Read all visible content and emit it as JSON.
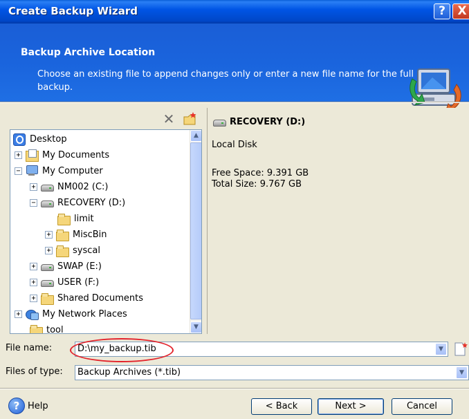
{
  "window": {
    "title": "Create Backup Wizard",
    "help_glyph": "?",
    "close_glyph": "X"
  },
  "header": {
    "title": "Backup Archive Location",
    "description": "Choose an existing file to append changes only or enter a new file name for the full backup.",
    "icon": "backup-computer-icon"
  },
  "toolbar": {
    "delete_glyph": "✕",
    "new_folder_icon": "new-folder-icon"
  },
  "tree": {
    "items": [
      {
        "label": "Desktop",
        "icon": "desktop-icon",
        "expander": ""
      },
      {
        "label": "My Documents",
        "icon": "documents-icon",
        "expander": "+"
      },
      {
        "label": "My Computer",
        "icon": "computer-icon",
        "expander": "−"
      },
      {
        "label": "NM002 (C:)",
        "icon": "drive-icon",
        "expander": "+"
      },
      {
        "label": "RECOVERY (D:)",
        "icon": "drive-icon",
        "expander": "−"
      },
      {
        "label": "limit",
        "icon": "folder-icon",
        "expander": ""
      },
      {
        "label": "MiscBin",
        "icon": "folder-icon",
        "expander": "+"
      },
      {
        "label": "syscal",
        "icon": "folder-icon",
        "expander": "+"
      },
      {
        "label": "SWAP (E:)",
        "icon": "drive-icon",
        "expander": "+"
      },
      {
        "label": "USER (F:)",
        "icon": "drive-icon",
        "expander": "+"
      },
      {
        "label": "Shared Documents",
        "icon": "folder-icon",
        "expander": "+"
      },
      {
        "label": "My Network Places",
        "icon": "network-icon",
        "expander": "+"
      },
      {
        "label": "tool",
        "icon": "folder-icon",
        "expander": ""
      }
    ]
  },
  "info": {
    "drive_name": "RECOVERY (D:)",
    "type": "Local Disk",
    "free_space": "Free Space: 9.391 GB",
    "total_size": "Total Size: 9.767 GB"
  },
  "file_name": {
    "label": "File name:",
    "value": "D:\\my_backup.tib"
  },
  "file_type": {
    "label": "Files of type:",
    "value": "Backup Archives (*.tib)"
  },
  "buttons": {
    "help": "Help",
    "back": "< Back",
    "next": "Next >",
    "cancel": "Cancel"
  },
  "colors": {
    "accent": "#0055e5",
    "highlight_ellipse": "#e3232b"
  }
}
